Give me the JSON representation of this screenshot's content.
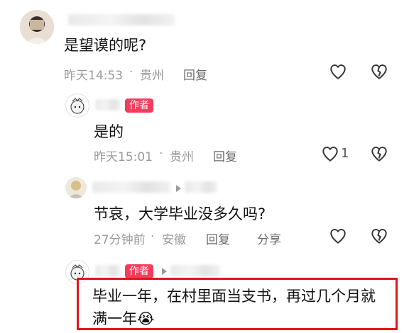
{
  "comment1": {
    "text": "是望谟的呢?",
    "time": "昨天14:53",
    "location": "贵州",
    "reply": "回复"
  },
  "comment2": {
    "author_tag": "作者",
    "text": "是的",
    "time": "昨天15:01",
    "location": "贵州",
    "reply": "回复",
    "like_count": "1"
  },
  "comment3": {
    "text": "节哀，大学毕业没多久吗?",
    "time": "27分钟前",
    "location": "安徽",
    "reply": "回复",
    "share": "分享"
  },
  "comment4": {
    "author_tag": "作者",
    "text_line1": "毕业一年，在村里面当支书，再过几个月就",
    "text_line2": "满一年😭"
  },
  "separator": "·",
  "colors": {
    "author_tag": "#f23d5c",
    "highlight_border": "#e5141b",
    "meta_text": "#9a9a9a"
  }
}
